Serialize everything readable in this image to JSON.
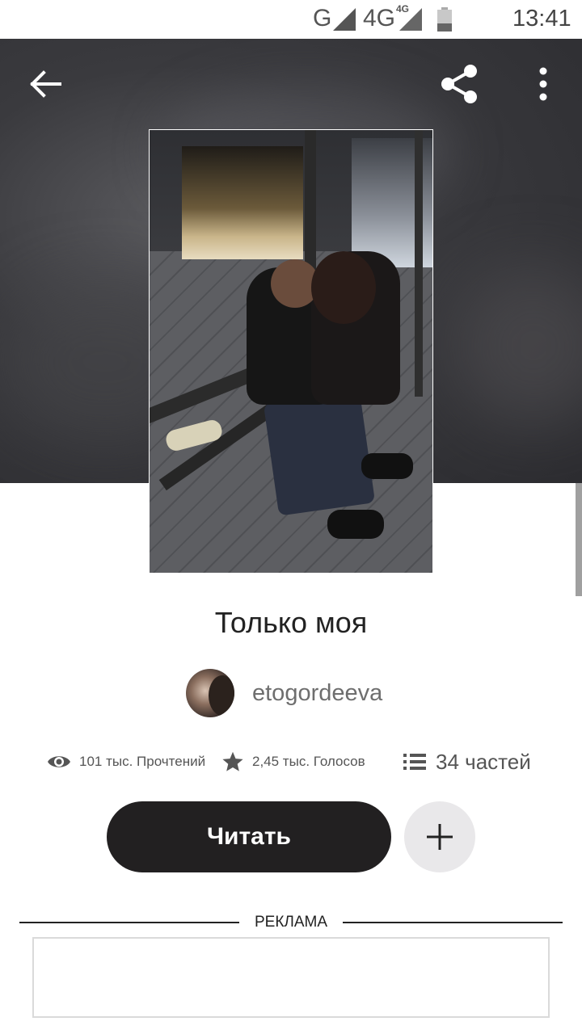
{
  "status_bar": {
    "network1": "G",
    "network2": "4G",
    "network2_small": "4G",
    "time": "13:41"
  },
  "header": {
    "back_icon": "arrow-left-icon",
    "share_icon": "share-icon",
    "more_icon": "more-vertical-icon"
  },
  "story": {
    "title": "Только моя",
    "author": "etogordeeva",
    "stats": {
      "reads": "101 тыс. Прочтений",
      "votes": "2,45 тыс. Голосов",
      "parts": "34 частей"
    }
  },
  "actions": {
    "read_label": "Читать",
    "add_icon": "plus-icon"
  },
  "ad": {
    "label": "РЕКЛАМА"
  }
}
